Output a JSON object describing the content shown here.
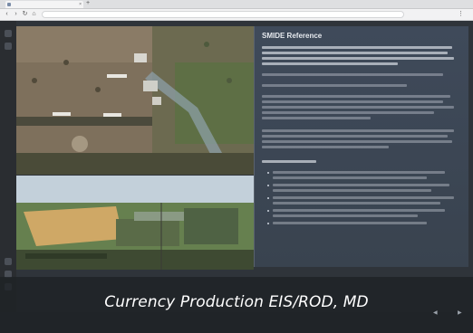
{
  "caption": {
    "text": "Currency Production EIS/ROD, MD"
  },
  "panel": {
    "title": "SMIDE Reference"
  },
  "colors": {
    "caption_bar": "#1e2125",
    "panel_bg": "#3f4a5a",
    "browser_chrome": "#f2f2f3"
  },
  "icons": [
    "back-arrow-icon",
    "forward-arrow-icon",
    "reload-icon",
    "home-icon",
    "menu-dots-icon",
    "tab-close-icon",
    "new-tab-icon"
  ]
}
